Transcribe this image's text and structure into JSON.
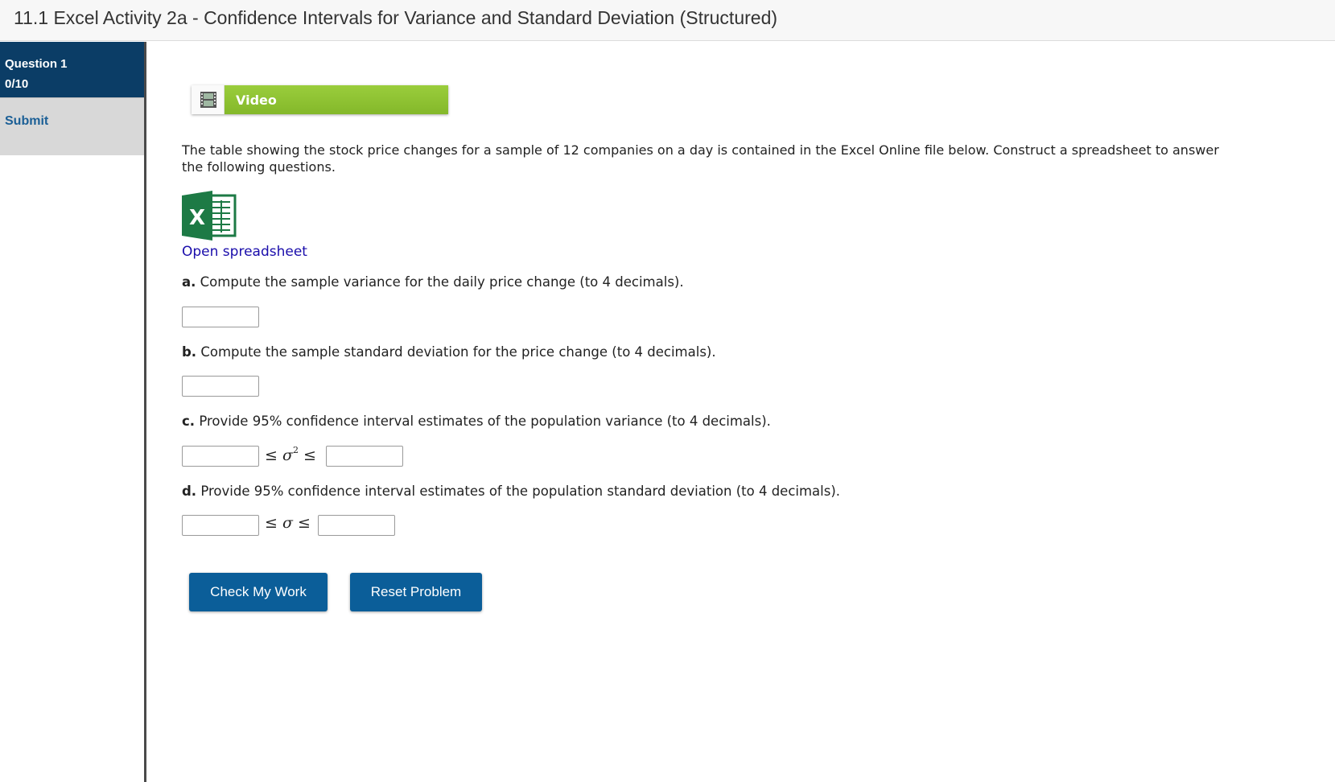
{
  "page": {
    "title": "11.1 Excel Activity 2a - Confidence Intervals for Variance and Standard Deviation (Structured)"
  },
  "sidebar": {
    "question_label": "Question 1",
    "question_score": "0/10",
    "submit_label": "Submit"
  },
  "video": {
    "label": "Video",
    "icon": "film-icon"
  },
  "intro": "The table showing the stock price changes for a sample of 12 companies on a day is contained in the Excel Online file below. Construct a spreadsheet to answer the following questions.",
  "spreadsheet": {
    "icon": "excel-icon",
    "link_label": "Open spreadsheet"
  },
  "questions": [
    {
      "letter": "a.",
      "text": "Compute the sample variance for the daily price change (to 4 decimals).",
      "value": ""
    },
    {
      "letter": "b.",
      "text": "Compute the sample standard deviation for the price change (to 4 decimals).",
      "value": ""
    },
    {
      "letter": "c.",
      "text": "Provide 95% confidence interval estimates of the population variance (to 4 decimals).",
      "lower": "",
      "upper": "",
      "symbol": "≤ σ",
      "exponent": "2",
      "symbol_end": " ≤"
    },
    {
      "letter": "d.",
      "text": "Provide 95% confidence interval estimates of the population standard deviation (to 4 decimals).",
      "lower": "",
      "upper": "",
      "symbol": "≤ σ ≤"
    }
  ],
  "buttons": {
    "check": "Check My Work",
    "reset": "Reset Problem"
  },
  "colors": {
    "nav_active": "#0b3d66",
    "video_green": "#8dc233",
    "button_blue": "#0b5e99",
    "link_blue": "#1a0dab"
  }
}
